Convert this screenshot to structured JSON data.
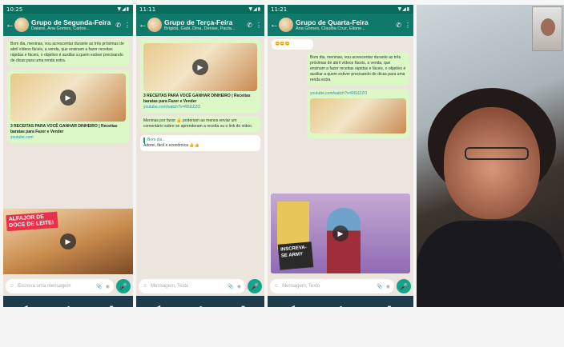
{
  "phones": [
    {
      "id": "p1",
      "status_time": "10:25",
      "chat_title": "Grupo de Segunda-Feira",
      "chat_subtitle": "Daiane, Ana Gomes, Carlos...",
      "messages": [
        {
          "kind": "text",
          "text": "Bom dia, meninas, vou acrescentar durante as três próximas de abril vídeos fáceis, a venda, que ensinam a fazer receitas rápidas e fáceis, o objetivo é auxiliar a quem estiver precisando de dicas para uma renda extra."
        },
        {
          "kind": "media",
          "caption": "3 RECEITAS PARA VOCÊ GANHAR DINHEIRO | Receitas baratas para Fazer e Vender",
          "link": "youtube.com"
        }
      ],
      "promo_label": "ALFAJOR DE DOCE DE LEITE!",
      "input_placeholder": "Escreva uma mensagem"
    },
    {
      "id": "p2",
      "status_time": "11:11",
      "chat_title": "Grupo de Terça-Feira",
      "chat_subtitle": "Brígida, Gabi, Dina, Denise, Paula...",
      "messages": [
        {
          "kind": "media",
          "caption": "3 RECEITAS PARA VOCÊ GANHAR DINHEIRO | Receitas baratas para Fazer e Vender",
          "link": "youtube.com/watch?v=R6UZZO"
        },
        {
          "kind": "text",
          "text": "Meninas por favor 👍 poderiam ao menos enviar um comentário sobre se aprenderam a receita ou o link do vídeo."
        },
        {
          "kind": "reply",
          "quote": "Bom dia...",
          "text": "Adorei, fácil e econômica 👍👍"
        }
      ],
      "input_placeholder": "Mensagem, Texto"
    },
    {
      "id": "p3",
      "status_time": "11:21",
      "chat_title": "Grupo de Quarta-Feira",
      "chat_subtitle": "Ana Gomes, Claudia Cruz, Eliane...",
      "emoji_row": "😊😊😊",
      "messages": [
        {
          "kind": "text",
          "text": "Bom dia, meninas, vou acrescentar durante as três próximas de abril vídeos fáceis, a venda, que ensinam a fazer receitas rápidas e fáceis, o objetivo é auxiliar a quem estiver precisando de dicas para uma renda extra."
        },
        {
          "kind": "link",
          "link": "youtube.com/watch?v=R6UZZO"
        }
      ],
      "yt_sign": "INSCREVA-SE ARMY",
      "input_placeholder": "Mensagem, Texto"
    }
  ],
  "nav": {
    "back": "◀",
    "home": "●",
    "recent": "■"
  }
}
